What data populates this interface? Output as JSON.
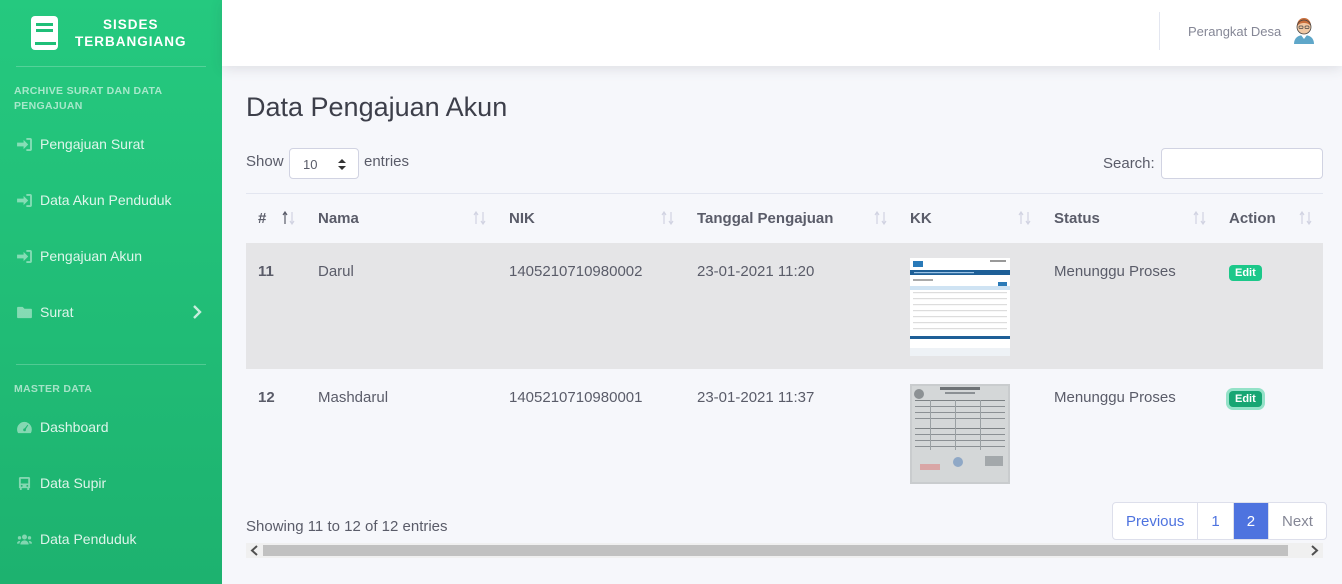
{
  "brand": {
    "line1": "SISDES",
    "line2": "TERBANGIANG"
  },
  "sidebar": {
    "heading_archive": "ARCHIVE SURAT DAN DATA PENGAJUAN",
    "archive_items": [
      {
        "label": "Pengajuan Surat",
        "icon": "sign-in-icon"
      },
      {
        "label": "Data Akun Penduduk",
        "icon": "sign-in-icon"
      },
      {
        "label": "Pengajuan Akun",
        "icon": "sign-in-icon"
      },
      {
        "label": "Surat",
        "icon": "folder-icon"
      }
    ],
    "heading_master": "MASTER DATA",
    "master_items": [
      {
        "label": "Dashboard",
        "icon": "tachometer-icon"
      },
      {
        "label": "Data Supir",
        "icon": "bus-icon"
      },
      {
        "label": "Data Penduduk",
        "icon": "users-icon"
      }
    ]
  },
  "topbar": {
    "user_name": "Perangkat Desa"
  },
  "main": {
    "title": "Data Pengajuan Akun",
    "show_label": "Show",
    "entries_value": "10",
    "entries_label": "entries",
    "search_label": "Search:",
    "columns": [
      "#",
      "Nama",
      "NIK",
      "Tanggal Pengajuan",
      "KK",
      "Status",
      "Action"
    ],
    "rows": [
      {
        "id": "11",
        "nama": "Darul",
        "nik": "1405210710980002",
        "tanggal": "23-01-2021 11:20",
        "status": "Menunggu Proses",
        "action": "Edit"
      },
      {
        "id": "12",
        "nama": "Mashdarul",
        "nik": "1405210710980001",
        "tanggal": "23-01-2021 11:37",
        "status": "Menunggu Proses",
        "action": "Edit"
      }
    ],
    "info": "Showing 11 to 12 of 12 entries",
    "pagination": {
      "previous": "Previous",
      "page1": "1",
      "page2": "2",
      "next": "Next"
    }
  },
  "colors": {
    "sidebar": "#1db26f",
    "primary": "#4e73df",
    "success": "#1cc88a"
  }
}
